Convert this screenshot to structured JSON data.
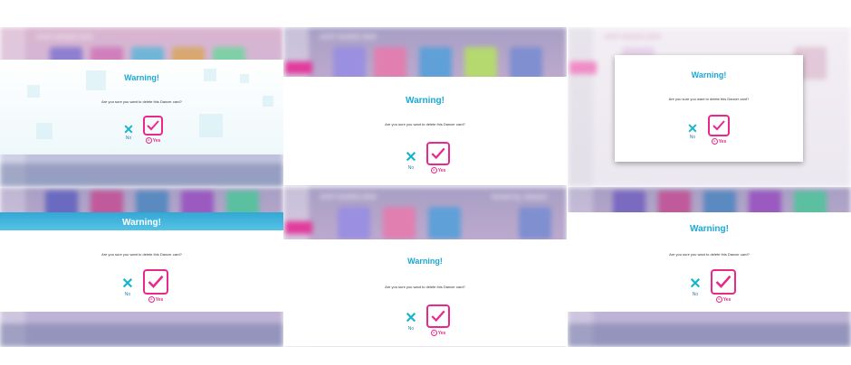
{
  "background": {
    "game_title": "JUST DANCE 2019",
    "sort_label": "Sorted by: Newest"
  },
  "dialog": {
    "title": "Warning!",
    "question": "Are you sure you want to delete this Dancer card?",
    "no_label": "No",
    "yes_label": "Yes",
    "yes_hint_glyph": "A"
  },
  "colors": {
    "title_blue": "#1aa9d6",
    "no_cross": "#18b4ce",
    "yes_magenta": "#e8298b"
  },
  "icons": {
    "no": "cross-icon",
    "yes": "checkmark-icon",
    "hint": "a-button-icon"
  }
}
